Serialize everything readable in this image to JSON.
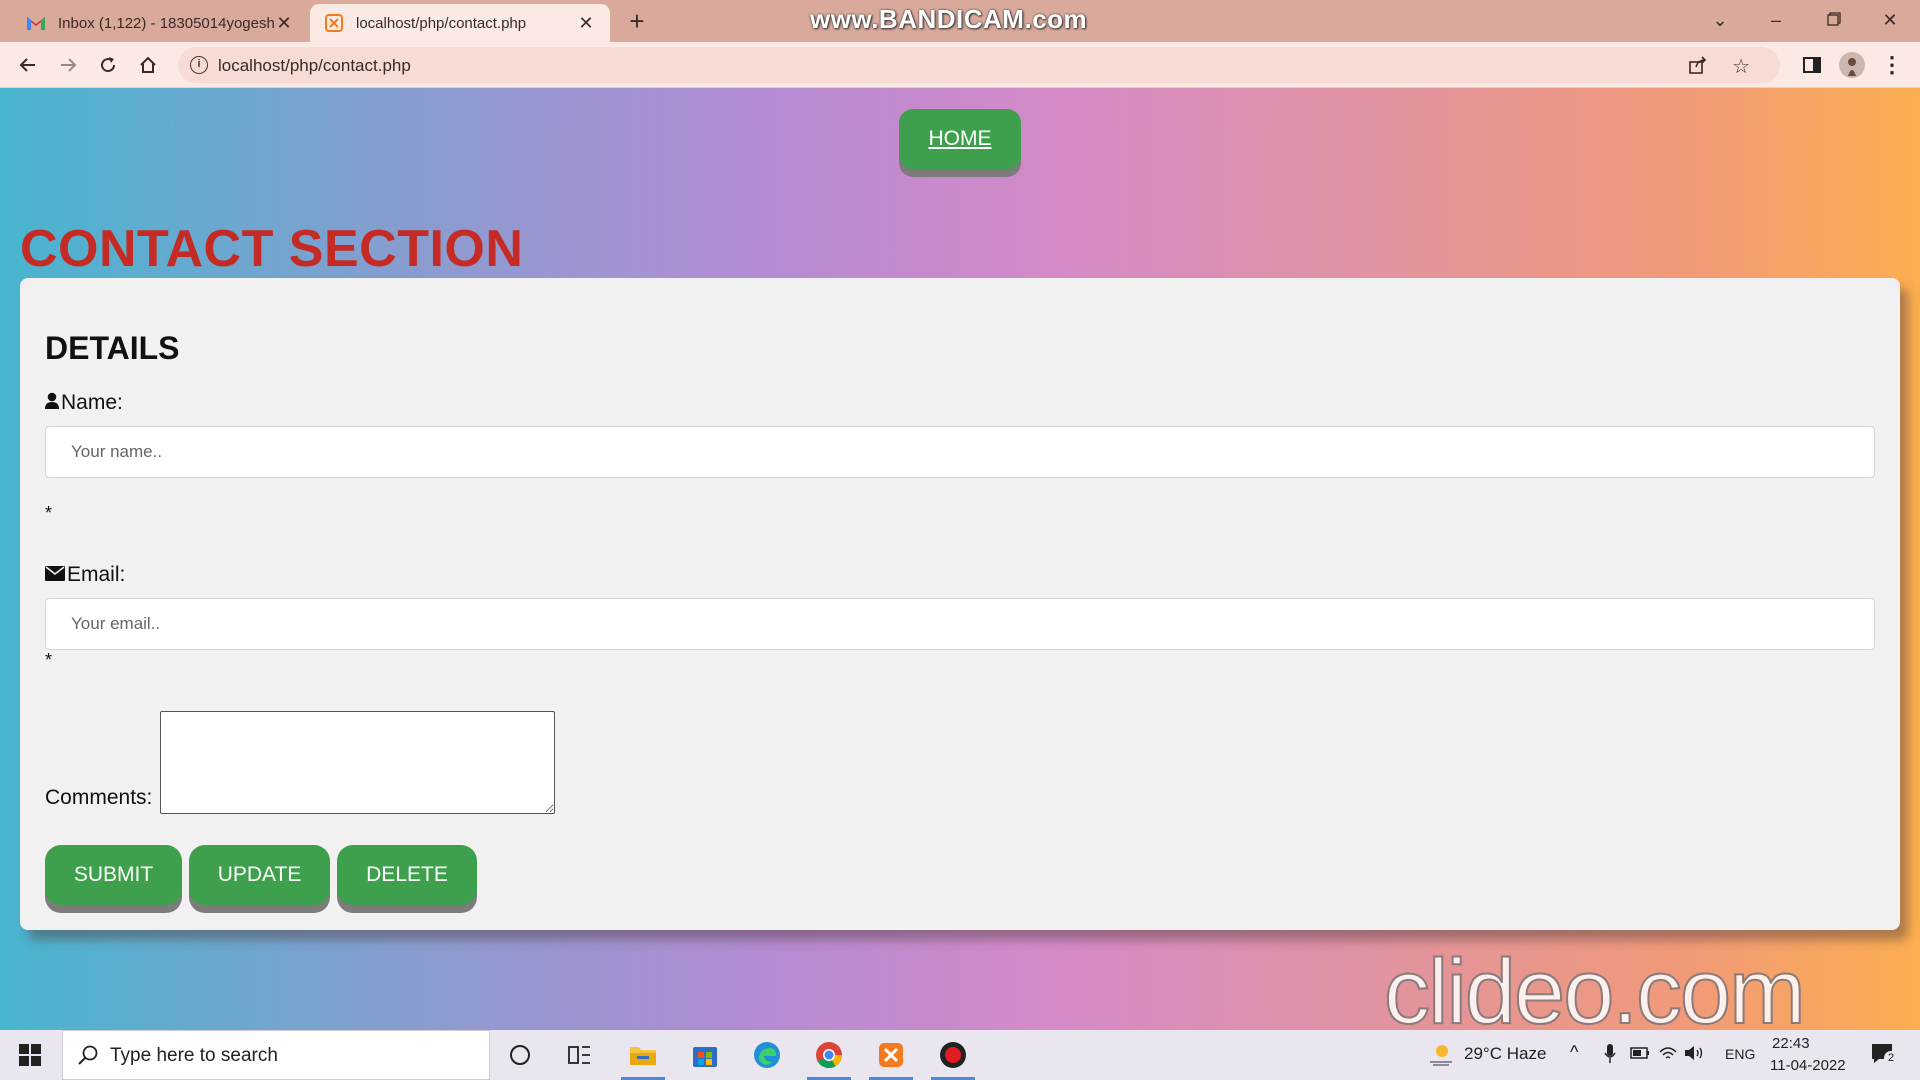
{
  "browser": {
    "tabs": [
      {
        "title": "Inbox (1,122) - 18305014yogeshw",
        "icon": "gmail-icon"
      },
      {
        "title": "localhost/php/contact.php",
        "icon": "xampp-icon"
      }
    ],
    "new_tab": "+",
    "url": "localhost/php/contact.php",
    "watermark_top": "www.BANDICAM.com"
  },
  "page": {
    "home_label": "HOME",
    "heading": "CONTACT SECTION",
    "form": {
      "title": "DETAILS",
      "name_label": "Name:",
      "name_placeholder": "Your name..",
      "required_mark": "*",
      "email_label": "Email:",
      "email_placeholder": "Your email..",
      "comments_label": "Comments:",
      "buttons": [
        "SUBMIT",
        "UPDATE",
        "DELETE"
      ]
    },
    "watermark_bottom": "clideo.com"
  },
  "taskbar": {
    "search_placeholder": "Type here to search",
    "weather": "29°C  Haze",
    "language": "ENG",
    "time": "22:43",
    "date": "11-04-2022",
    "notifications": "2"
  },
  "colors": {
    "accent_green": "#3e9f4c",
    "heading_red": "#c52b25"
  }
}
